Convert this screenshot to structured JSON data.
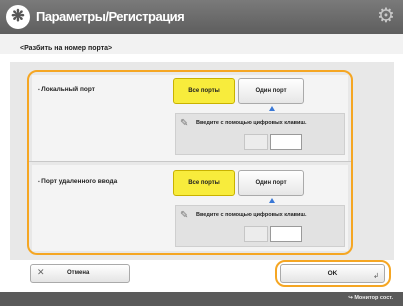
{
  "header": {
    "title": "Параметры/Регистрация",
    "app_icon": "settings-register-icon",
    "settings_icon": "gear-icon"
  },
  "subtitle": "<Разбить на номер порта>",
  "sections": [
    {
      "label": "Локальный порт",
      "options": [
        "Все порты",
        "Один порт"
      ],
      "selected": "Все порты",
      "port_hint": "Введите с помощью цифровых клавиш.",
      "port_value": ""
    },
    {
      "label": "Порт удаленного ввода",
      "options": [
        "Все порты",
        "Один порт"
      ],
      "selected": "Все порты",
      "port_hint": "Введите с помощью цифровых клавиш.",
      "port_value": ""
    }
  ],
  "footer_buttons": {
    "cancel": "Отмена",
    "ok": "OK"
  },
  "status_bar": {
    "text": "Монитор сост."
  },
  "colors": {
    "selected_option": "#f8ec3c",
    "focus_frame": "#f5a623",
    "title_bar": "#666666"
  }
}
